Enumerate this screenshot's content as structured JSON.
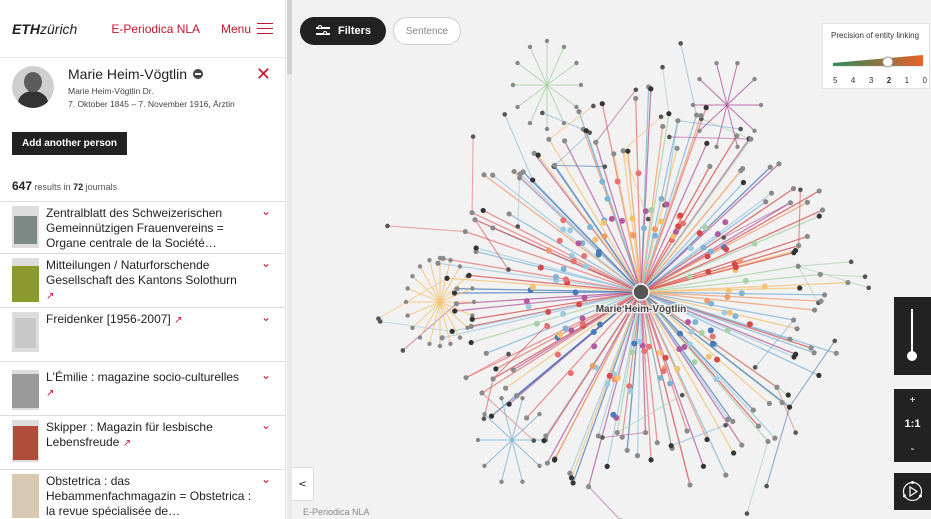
{
  "header": {
    "eth_logo_bold": "ETH",
    "eth_logo_rest": "zürich",
    "brand": "E-Periodica NLA",
    "menu_label": "Menu"
  },
  "person": {
    "name": "Marie Heim-Vögtlin",
    "alias": "Marie Heim-Vögtlin Dr.",
    "dates": "7. Oktober 1845 – 7. November 1916, Ärztin",
    "close_symbol": "✕"
  },
  "add_person_label": "Add another person",
  "results": {
    "count": "647",
    "text_mid": "results in",
    "journals_count": "72",
    "text_end": "journals"
  },
  "journals": [
    {
      "title": "Zentralblatt des Schweizerischen Gemeinnützigen Frauenvereins = Organe centrale de la Société…",
      "external": "",
      "thumb_color": "#7e8a86"
    },
    {
      "title": "Mitteilungen / Naturforschende Gesellschaft des Kantons Solothurn",
      "external": "↗",
      "thumb_color": "#8a9a2e"
    },
    {
      "title": "Freidenker [1956-2007]",
      "external": "↗",
      "thumb_color": "#c8c8c8"
    },
    {
      "title": "L'Émilie : magazine socio-culturelles",
      "external": "↗",
      "thumb_color": "#9a9a9a"
    },
    {
      "title": "Skipper : Magazin für lesbische Lebensfreude",
      "external": "↗",
      "thumb_color": "#b04d3a"
    },
    {
      "title": "Obstetrica : das Hebammenfachmagazin = Obstetrica : la revue spécialisée de…",
      "external": "",
      "thumb_color": "#d8c9b2"
    }
  ],
  "chevron_symbol": "⌄",
  "toolbar": {
    "filters_label": "Filters",
    "sentence_label": "Sentence"
  },
  "precision": {
    "title": "Precision of entity linking",
    "levels": [
      "5",
      "4",
      "3",
      "2",
      "1",
      "0"
    ],
    "selected_level": "2",
    "gradient_left": "#2a8b57",
    "gradient_right": "#e8602c"
  },
  "graph": {
    "center_label": "Marie Heim-Vögtlin",
    "edge_colors": [
      "#e57373",
      "#d74a4a",
      "#7fb3d5",
      "#4a7ab7",
      "#f6c270",
      "#a7d1a7",
      "#b35a9e",
      "#ef9a6a",
      "#9ecae1"
    ]
  },
  "collapse_symbol": "<",
  "footer_label": "E-Periodica NLA",
  "zoom": {
    "plus": "+",
    "one_to_one": "1:1",
    "minus": "-",
    "slider_level": 0.9
  }
}
